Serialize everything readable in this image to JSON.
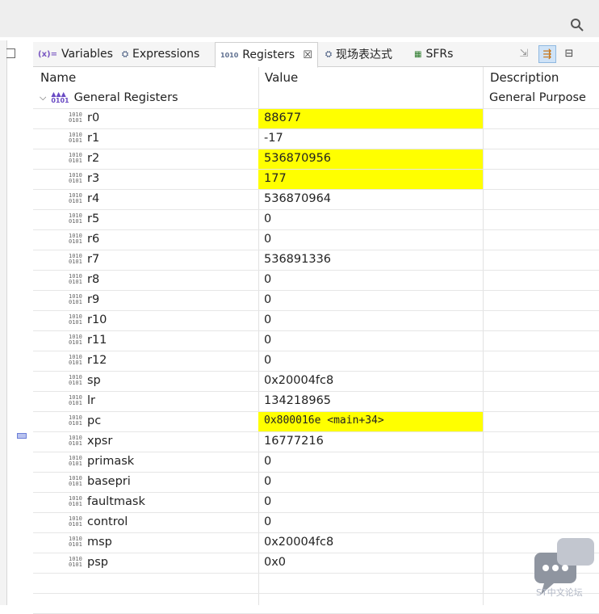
{
  "tabs": [
    {
      "icon": "(x)=",
      "label": "Variables"
    },
    {
      "icon": "⛭",
      "label": "Expressions"
    },
    {
      "icon": "1010",
      "label": "Registers",
      "close": "☒"
    },
    {
      "icon": "⛭",
      "label": "现场表达式"
    },
    {
      "icon": "▦",
      "label": "SFRs"
    }
  ],
  "columns": {
    "name": "Name",
    "value": "Value",
    "description": "Description"
  },
  "group": {
    "label": "General Registers",
    "description": "General Purpose"
  },
  "registers": [
    {
      "name": "r0",
      "value": "88677",
      "highlight": true
    },
    {
      "name": "r1",
      "value": "-17",
      "highlight": false
    },
    {
      "name": "r2",
      "value": "536870956",
      "highlight": true
    },
    {
      "name": "r3",
      "value": "177",
      "highlight": true
    },
    {
      "name": "r4",
      "value": "536870964",
      "highlight": false
    },
    {
      "name": "r5",
      "value": "0",
      "highlight": false
    },
    {
      "name": "r6",
      "value": "0",
      "highlight": false
    },
    {
      "name": "r7",
      "value": "536891336",
      "highlight": false
    },
    {
      "name": "r8",
      "value": "0",
      "highlight": false
    },
    {
      "name": "r9",
      "value": "0",
      "highlight": false
    },
    {
      "name": "r10",
      "value": "0",
      "highlight": false
    },
    {
      "name": "r11",
      "value": "0",
      "highlight": false
    },
    {
      "name": "r12",
      "value": "0",
      "highlight": false
    },
    {
      "name": "sp",
      "value": "0x20004fc8",
      "highlight": false
    },
    {
      "name": "lr",
      "value": "134218965",
      "highlight": false
    },
    {
      "name": "pc",
      "value": "0x800016e <main+34>",
      "highlight": true
    },
    {
      "name": "xpsr",
      "value": "16777216",
      "highlight": false
    },
    {
      "name": "primask",
      "value": "0",
      "highlight": false
    },
    {
      "name": "basepri",
      "value": "0",
      "highlight": false
    },
    {
      "name": "faultmask",
      "value": "0",
      "highlight": false
    },
    {
      "name": "control",
      "value": "0",
      "highlight": false
    },
    {
      "name": "msp",
      "value": "0x20004fc8",
      "highlight": false
    },
    {
      "name": "psp",
      "value": "0x0",
      "highlight": false
    }
  ],
  "watermark": "ST中文论坛",
  "colors": {
    "highlight": "#ffff00",
    "grid": "#e6e6e6"
  }
}
